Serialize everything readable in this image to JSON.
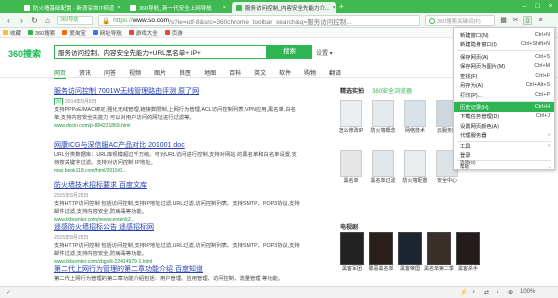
{
  "tabs": [
    {
      "label": "防火墙基础配置 - 新浪深圳IT频道"
    },
    {
      "label": "360导航_新一代安全上网导航"
    },
    {
      "label": "服务访问控制_内容安全先能力介..."
    }
  ],
  "address": {
    "proto": "https://",
    "host": "www.so.com",
    "rest": "/s?ie=utf-8&src=360chrome_toolbar_search&q=服务访问控制...",
    "search_placeholder": "360搜索关键词(F)"
  },
  "bookmarks": [
    {
      "label": "收藏",
      "color": "#f2c037"
    },
    {
      "label": "360搜索",
      "color": "#2fb454"
    },
    {
      "label": "爱淘宝",
      "color": "#ff6a00"
    },
    {
      "label": "网址导航",
      "color": "#3b78e7"
    },
    {
      "label": "游戏大全",
      "color": "#e8453c"
    },
    {
      "label": "页游",
      "color": "#e8453c"
    }
  ],
  "search": {
    "logo": "360搜索",
    "query": "服务访问控制、内容安全先能力+URL黑名单+ IP+",
    "button": "搜索",
    "settings": "设置 ▾"
  },
  "nav_tabs": [
    "网页",
    "资讯",
    "问答",
    "视频",
    "图片",
    "良医",
    "地图",
    "百科",
    "英文",
    "软件",
    "购物",
    "翻译"
  ],
  "results": [
    {
      "title": "服务访问控制 7001W无线管理路由评测 原了网",
      "date": "2014年8月5日",
      "desc": "支持PPPoE/MAC绑定,强化无线管理,链接数限制,上网行为管理,ACL访问控制列表,VPN应用,黑名单,白名单,支持内容安全先能力 可以对用户访问的网址进行过滤等。",
      "url": "www.docin.com/p-884221869.html"
    },
    {
      "title": "网康ICG与深信服AC产品对比 201001 doc",
      "date": "",
      "desc": "URL分类数据库：URL库规模超过千万级。可对URL访问进行控制,支持对网站 的黑名单和白名单设置,支持按关键字过滤。支持对访问控制 IP地址。",
      "url": "max.book118.com/html/2015/0..."
    },
    {
      "title": "防火墙技术招标要求 百度文库",
      "date": "2015年8月25日",
      "desc": "支持HTTP访问控制 包括访问控制,支持IP地址过滤,URL过滤,访问控制列表。支持SMTP、POP3协议,支持邮件过滤,支持内容安全,防病毒等功能。",
      "url": "www.txbcenter.com/newscenter/k2..."
    },
    {
      "title": "遥感防火墙招标公告 遥感招标网",
      "date": "2015年8月25日",
      "desc": "支持HTTP访问控制 包括访问控制,支持IP地址过滤,URL过滤,访问控制列表。支持SMTP、POP3协议,支持邮件过滤,支持内容安全,防病毒等功能。",
      "url": "www.txbcenter.com/zbgs/k-22414979-1.html"
    },
    {
      "title": "第二代上网行为管理的第二章功能介绍 百度知道",
      "date": "",
      "desc": "第二代上网行为管理的第二章功能介绍包括：用户管理、应用管理、访问控制、流量管理 等功能。",
      "url": ""
    }
  ],
  "side": {
    "head": "精选实拍",
    "sub": "360安全浏览器",
    "thumbs": [
      "怎么修改IP",
      "防火墙概念",
      "网络技术",
      "云服务器",
      "黑名单",
      "黑名单过滤",
      "防火墙配置",
      "安全中心"
    ],
    "tv_head": "电视剧",
    "posters": [
      "黑客军团",
      "罪恶黑名单",
      "黑客帝国",
      "黑名单第二季",
      "黑客杀手"
    ]
  },
  "menu": [
    {
      "label": "新建窗口(N)",
      "key": "Ctrl+N"
    },
    {
      "label": "新建隐身窗口(I)",
      "key": "Ctrl+Shift+N"
    },
    {
      "sep": true
    },
    {
      "label": "保存网页(A)",
      "key": "Ctrl+S"
    },
    {
      "label": "保存网页为图片(M)",
      "key": "Ctrl+M"
    },
    {
      "label": "查找(F)",
      "key": "Ctrl+F"
    },
    {
      "label": "另存为(A)",
      "key": "Ctrl+Alt+S"
    },
    {
      "label": "打印(P)...",
      "key": "Ctrl+P"
    },
    {
      "sep": true
    },
    {
      "label": "历史记录(H)",
      "key": "Ctrl+H",
      "hl": true
    },
    {
      "label": "下载任务管理(D)",
      "key": "Ctrl+J"
    },
    {
      "label": "设置网页颜色(A)",
      "key": ""
    },
    {
      "label": "代理服务器",
      "key": "›"
    },
    {
      "sep": true
    },
    {
      "label": "工具",
      "key": "›"
    },
    {
      "label": "登录",
      "key": ""
    },
    {
      "sep": true
    },
    {
      "label": "选项(O)",
      "key": ""
    },
    {
      "label": "帮助",
      "key": "›"
    }
  ],
  "status": {
    "left": "✓",
    "zoom": "100%"
  }
}
